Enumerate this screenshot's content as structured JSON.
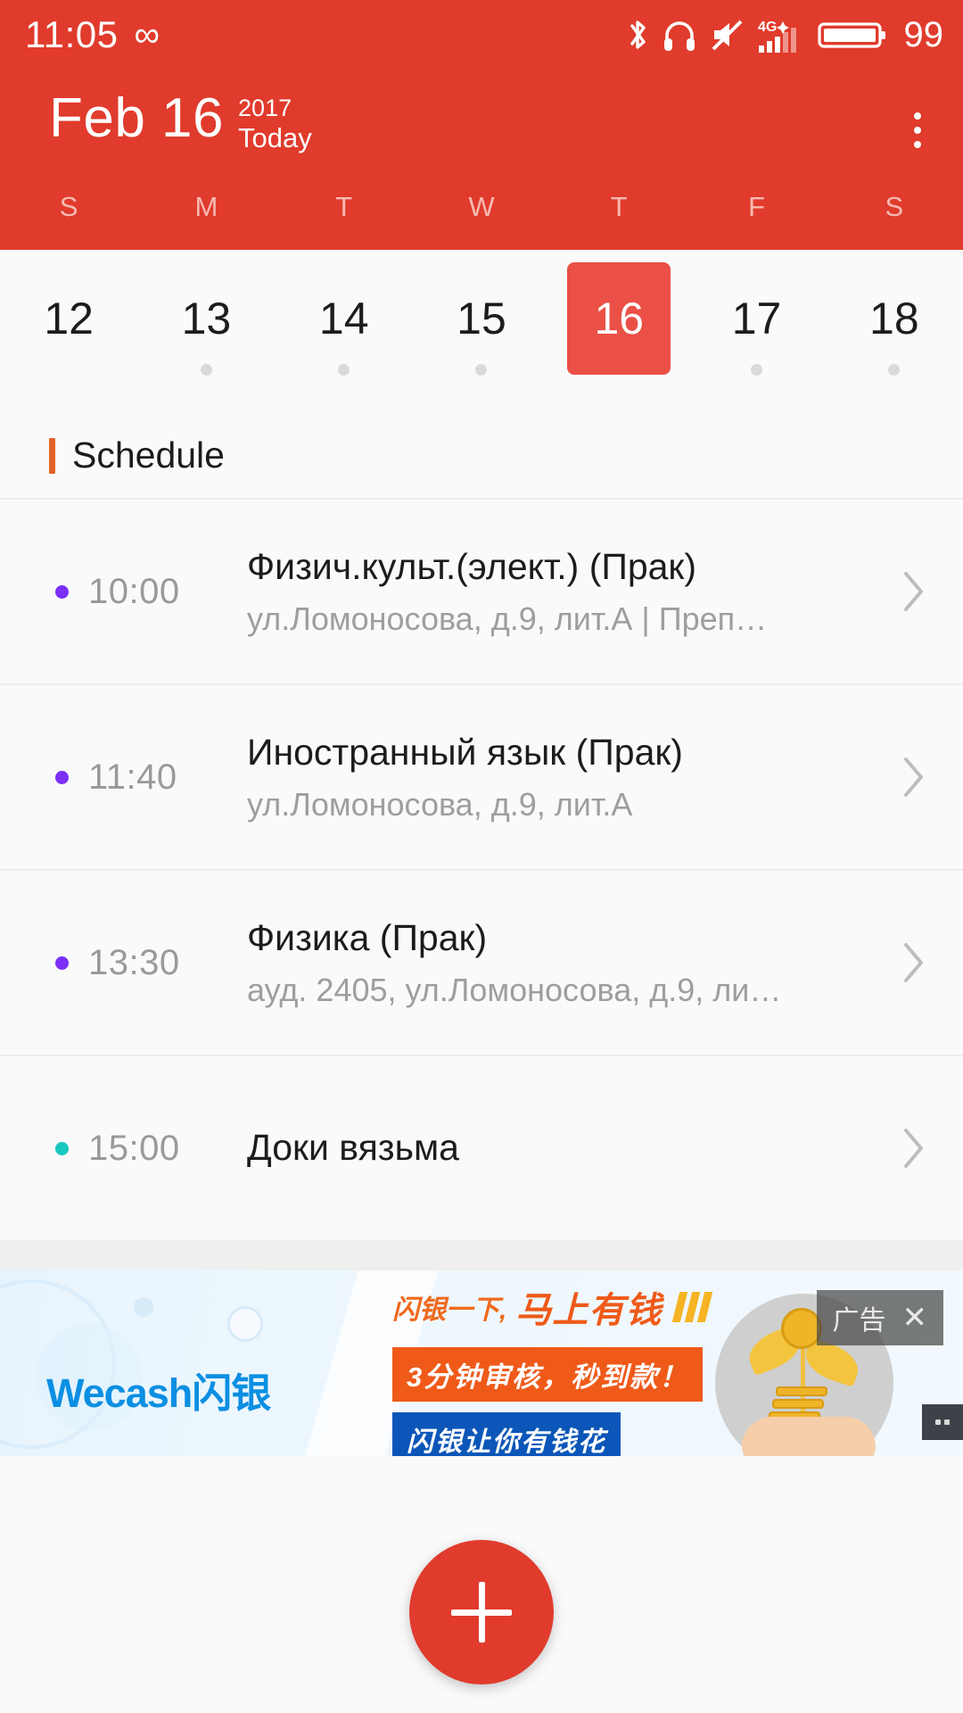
{
  "status_bar": {
    "time": "11:05",
    "infinity_icon": "infinity-icon",
    "icons": [
      "bluetooth-icon",
      "headphones-icon",
      "mute-icon",
      "signal-4g-plus-icon",
      "battery-icon"
    ],
    "battery_level": "99",
    "network_label": "4G"
  },
  "header": {
    "month_day": "Feb 16",
    "year": "2017",
    "today_label": "Today",
    "overflow_menu": "overflow-menu-icon",
    "background_color": "#e03b2c",
    "weekdays": [
      "S",
      "M",
      "T",
      "W",
      "T",
      "F",
      "S"
    ]
  },
  "date_strip": {
    "days": [
      {
        "num": "12",
        "selected": false,
        "has_event": false
      },
      {
        "num": "13",
        "selected": false,
        "has_event": true
      },
      {
        "num": "14",
        "selected": false,
        "has_event": true
      },
      {
        "num": "15",
        "selected": false,
        "has_event": true
      },
      {
        "num": "16",
        "selected": true,
        "has_event": true
      },
      {
        "num": "17",
        "selected": false,
        "has_event": true
      },
      {
        "num": "18",
        "selected": false,
        "has_event": true
      }
    ],
    "selected_color": "#ea5045"
  },
  "schedule": {
    "section_title": "Schedule",
    "accent_color": "#e2642a",
    "events": [
      {
        "time": "10:00",
        "title": "Физич.культ.(элект.) (Прак)",
        "subtitle": "ул.Ломоносова, д.9, лит.А |  Преп…",
        "dot_color": "#7b2ff7"
      },
      {
        "time": "11:40",
        "title": "Иностранный язык (Прак)",
        "subtitle": "ул.Ломоносова, д.9, лит.А",
        "dot_color": "#7b2ff7"
      },
      {
        "time": "13:30",
        "title": "Физика (Прак)",
        "subtitle": "ауд. 2405, ул.Ломоносова, д.9, ли…",
        "dot_color": "#7b2ff7"
      },
      {
        "time": "15:00",
        "title": "Доки вязьма",
        "subtitle": "",
        "dot_color": "#19c7c0"
      }
    ]
  },
  "ad": {
    "brand": "Wecash闪银",
    "headline_small": "闪银一下,",
    "headline_big": "马上有钱",
    "tagline_orange": "3分钟审核，秒到款！",
    "tagline_blue": "闪银让你有钱花",
    "badge_label": "广告",
    "close_label": "✕"
  },
  "fab": {
    "label": "add-event",
    "color": "#e03b2c"
  }
}
